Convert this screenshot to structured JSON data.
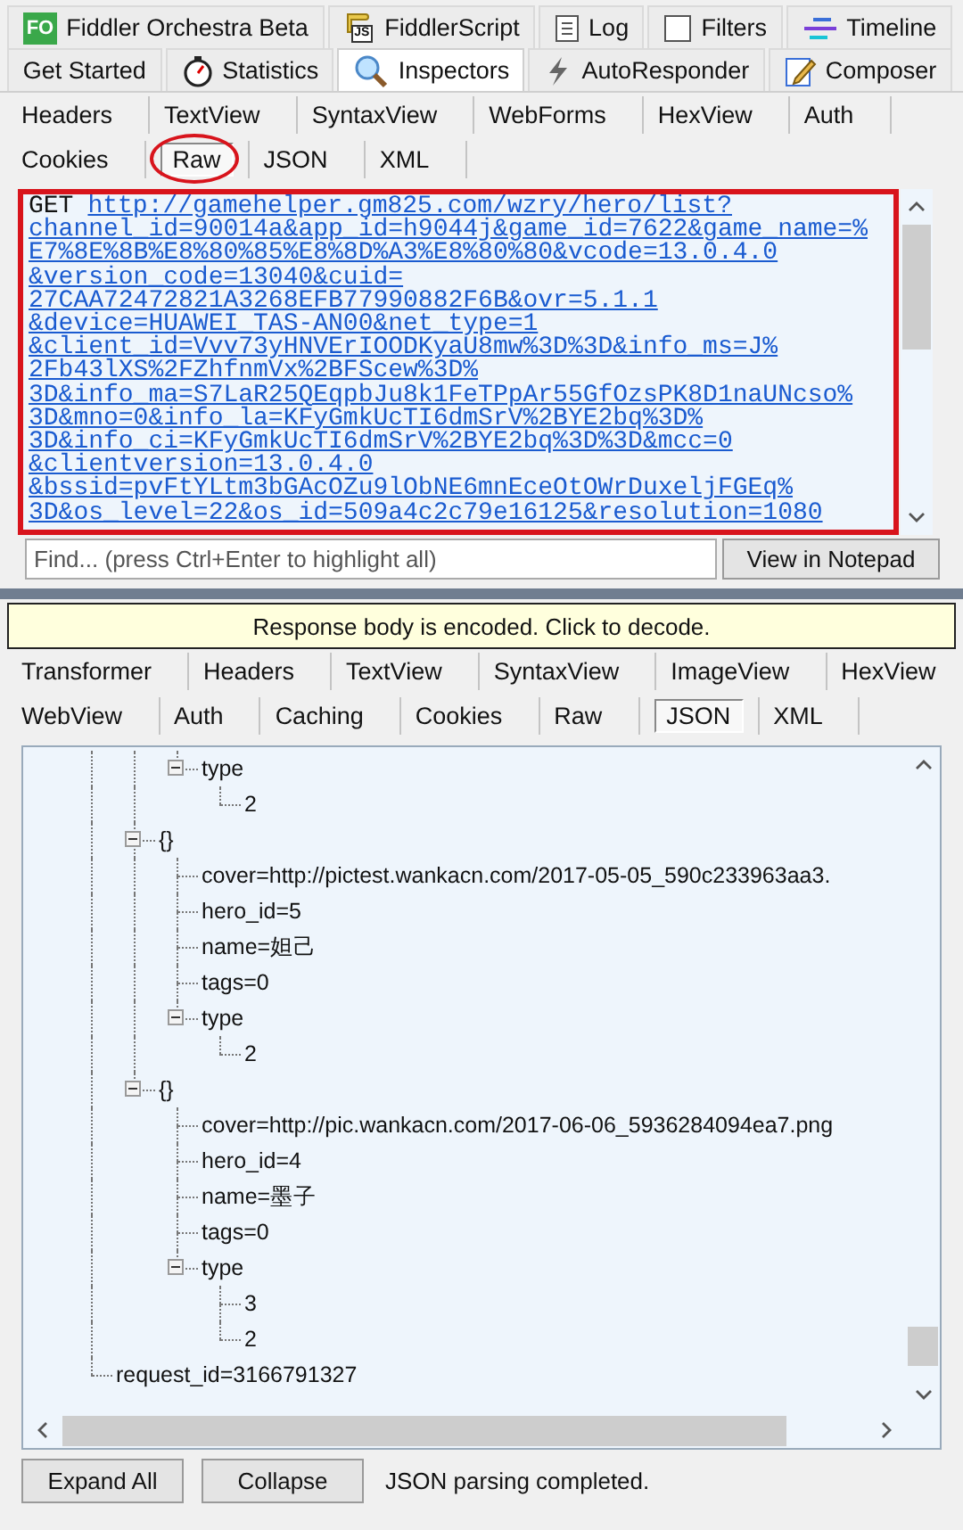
{
  "main_tabs": [
    [
      {
        "label": "Fiddler Orchestra Beta",
        "kind": "fo",
        "badge": "FO",
        "selected": false
      },
      {
        "label": "FiddlerScript",
        "kind": "js",
        "badge": "JS",
        "selected": false
      },
      {
        "label": "Log",
        "kind": "log",
        "selected": false
      },
      {
        "label": "Filters",
        "kind": "filters",
        "selected": false
      },
      {
        "label": "Timeline",
        "kind": "timeline",
        "selected": false
      }
    ],
    [
      {
        "label": "Get Started",
        "kind": "none",
        "selected": false
      },
      {
        "label": "Statistics",
        "kind": "stopwatch",
        "selected": false
      },
      {
        "label": "Inspectors",
        "kind": "inspect",
        "selected": true
      },
      {
        "label": "AutoResponder",
        "kind": "bolt",
        "selected": false
      },
      {
        "label": "Composer",
        "kind": "compose",
        "selected": false
      }
    ]
  ],
  "request_tabs": [
    [
      {
        "label": "Headers",
        "selected": false,
        "circled": false
      },
      {
        "label": "TextView",
        "selected": false,
        "circled": false
      },
      {
        "label": "SyntaxView",
        "selected": false,
        "circled": false
      },
      {
        "label": "WebForms",
        "selected": false,
        "circled": false
      },
      {
        "label": "HexView",
        "selected": false,
        "circled": false
      },
      {
        "label": "Auth",
        "selected": false,
        "circled": false
      }
    ],
    [
      {
        "label": "Cookies",
        "selected": false,
        "circled": false
      },
      {
        "label": "Raw",
        "selected": true,
        "circled": true
      },
      {
        "label": "JSON",
        "selected": false,
        "circled": false
      },
      {
        "label": "XML",
        "selected": false,
        "circled": false
      }
    ]
  ],
  "raw_request": {
    "highlighted": true,
    "method": "GET",
    "url_lines": [
      "http://gamehelper.gm825.com/wzry/hero/list?",
      "channel_id=90014a&app_id=h9044j&game_id=7622&game_name=%",
      "E7%8E%8B%E8%80%85%E8%8D%A3%E8%80%80&vcode=13.0.4.0",
      "&version_code=13040&cuid=",
      "27CAA72472821A3268EFB77990882F6B&ovr=5.1.1",
      "&device=HUAWEI_TAS-AN00&net_type=1",
      "&client_id=Vvv73yHNVErIOODKyaU8mw%3D%3D&info_ms=J%",
      "2Fb43lXS%2FZhfnmVx%2BFScew%3D%",
      "3D&info_ma=S7LaR25QEqpbJu8k1FeTPpAr55GfOzsPK8D1naUNcso%",
      "3D&mno=0&info_la=KFyGmkUcTI6dmSrV%2BYE2bq%3D%",
      "3D&info_ci=KFyGmkUcTI6dmSrV%2BYE2bq%3D%3D&mcc=0",
      "&clientversion=13.0.4.0",
      "&bssid=pvFtYLtm3bGAcOZu9lObNE6mnEceOtOWrDuxeljFGEq%",
      "3D&os_level=22&os_id=509a4c2c79e16125&resolution=1080"
    ]
  },
  "find": {
    "placeholder": "Find... (press Ctrl+Enter to highlight all)",
    "button": "View in Notepad"
  },
  "notice": "Response body is encoded. Click to decode.",
  "response_tabs": [
    [
      {
        "label": "Transformer",
        "selected": false
      },
      {
        "label": "Headers",
        "selected": false
      },
      {
        "label": "TextView",
        "selected": false
      },
      {
        "label": "SyntaxView",
        "selected": false
      },
      {
        "label": "ImageView",
        "selected": false
      },
      {
        "label": "HexView",
        "selected": false
      }
    ],
    [
      {
        "label": "WebView",
        "selected": false
      },
      {
        "label": "Auth",
        "selected": false
      },
      {
        "label": "Caching",
        "selected": false
      },
      {
        "label": "Cookies",
        "selected": false
      },
      {
        "label": "Raw",
        "selected": false
      },
      {
        "label": "JSON",
        "selected": true
      },
      {
        "label": "XML",
        "selected": false
      }
    ]
  ],
  "tree": {
    "children": [
      {
        "children": [
          {
            "children": [
              {
                "label": "type",
                "expanded": true,
                "children": [
                  {
                    "label": "2"
                  }
                ]
              }
            ]
          },
          {
            "label": "{}",
            "expanded": true,
            "children": [
              {
                "label": "cover=http://pictest.wankacn.com/2017-05-05_590c233963aa3."
              },
              {
                "label": "hero_id=5"
              },
              {
                "label": "name=妲己"
              },
              {
                "label": "tags=0"
              },
              {
                "label": "type",
                "expanded": true,
                "children": [
                  {
                    "label": "2"
                  }
                ]
              }
            ]
          },
          {
            "label": "{}",
            "expanded": true,
            "children": [
              {
                "label": "cover=http://pic.wankacn.com/2017-06-06_5936284094ea7.png"
              },
              {
                "label": "hero_id=4"
              },
              {
                "label": "name=墨子"
              },
              {
                "label": "tags=0"
              },
              {
                "label": "type",
                "expanded": true,
                "children": [
                  {
                    "label": "3"
                  },
                  {
                    "label": "2"
                  }
                ]
              }
            ]
          }
        ]
      },
      {
        "label": "request_id=3166791327"
      }
    ]
  },
  "bottom": {
    "buttons": [
      "Expand All",
      "Collapse"
    ],
    "status": "JSON parsing completed."
  }
}
